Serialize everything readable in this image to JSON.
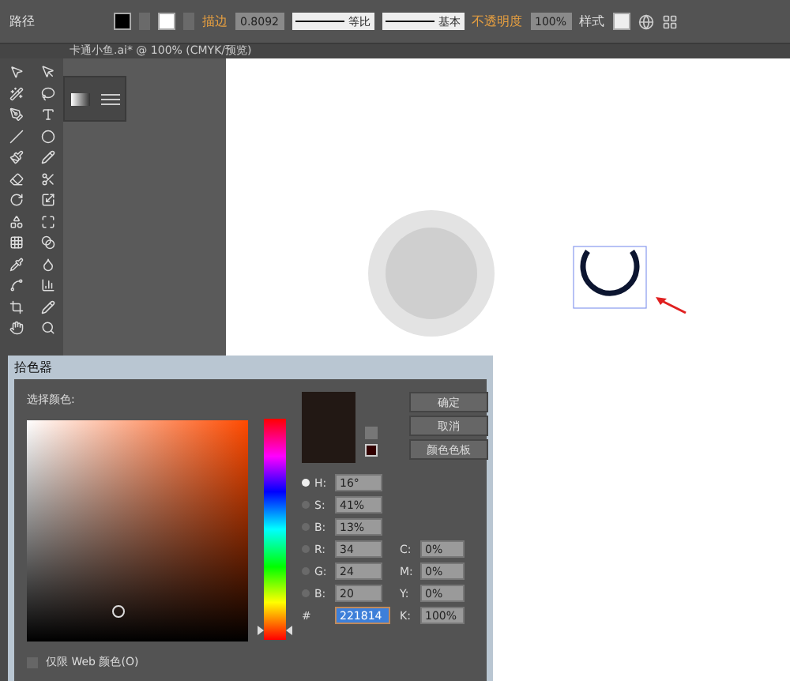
{
  "toolbar": {
    "object_type": "路径",
    "stroke_label": "描边",
    "stroke_weight": "0.8092",
    "profile": "等比",
    "brush": "基本",
    "opacity_label": "不透明度",
    "opacity": "100%",
    "style_label": "样式"
  },
  "document_tab": {
    "title": "卡通小鱼.ai* @ 100% (CMYK/预览)"
  },
  "color_picker": {
    "title": "拾色器",
    "prompt": "选择颜色:",
    "hue_slider": {
      "level": 0.04
    },
    "buttons": [
      "确定",
      "取消",
      "颜色色板"
    ],
    "hsb": [
      {
        "label": "H:",
        "value": "16°",
        "selected": true
      },
      {
        "label": "S:",
        "value": "41%",
        "selected": false
      },
      {
        "label": "B:",
        "value": "13%",
        "selected": false
      }
    ],
    "rgb": [
      {
        "label": "R:",
        "value": "34",
        "selected": false
      },
      {
        "label": "G:",
        "value": "24",
        "selected": false
      },
      {
        "label": "B:",
        "value": "20",
        "selected": false
      }
    ],
    "hex": {
      "label": "#",
      "value": "221814"
    },
    "cmyk": [
      {
        "label": "C:",
        "value": "0%"
      },
      {
        "label": "M:",
        "value": "0%"
      },
      {
        "label": "Y:",
        "value": "0%"
      },
      {
        "label": "K:",
        "value": "100%"
      }
    ],
    "web_only": {
      "label": "仅限 Web 颜色(O)",
      "checked": false
    }
  }
}
